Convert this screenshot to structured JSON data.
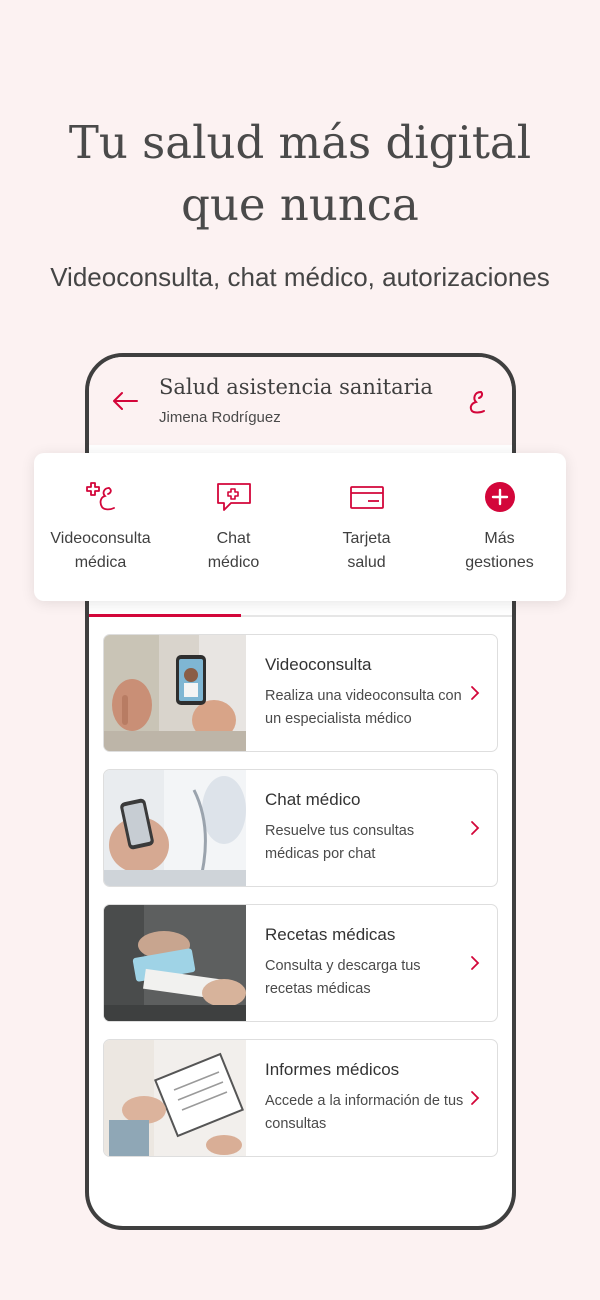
{
  "promo": {
    "headline_line1": "Tu salud más digital",
    "headline_line2": "que nunca",
    "subheadline": "Videoconsulta, chat médico, autorizaciones"
  },
  "app_header": {
    "back_icon": "arrow-left-icon",
    "title": "Salud asistencia sanitaria",
    "subtitle": "Jimena Rodríguez",
    "brand_icon": "brand-logo-icon"
  },
  "quick_actions": [
    {
      "label": "Videoconsulta\nmédica",
      "icon": "video-consult-icon"
    },
    {
      "label": "Chat\nmédico",
      "icon": "medical-chat-icon"
    },
    {
      "label": "Tarjeta\nsalud",
      "icon": "health-card-icon"
    },
    {
      "label": "Más\ngestiones",
      "icon": "plus-circle-icon"
    }
  ],
  "services": [
    {
      "title": "Videoconsulta",
      "description": "Realiza una videoconsulta con un especialista médico",
      "image": "woman waving at doctor on phone video call"
    },
    {
      "title": "Chat médico",
      "description": "Resuelve tus consultas médicas por chat",
      "image": "doctor holding smartphone"
    },
    {
      "title": "Recetas médicas",
      "description": "Consulta y descarga tus recetas médicas",
      "image": "hands exchanging health card"
    },
    {
      "title": "Informes médicos",
      "description": "Accede a la información de tus consultas",
      "image": "person signing medical clipboard"
    }
  ],
  "colors": {
    "accent": "#d3063a",
    "background": "#fcf2f2",
    "text": "#3f3f3f"
  }
}
